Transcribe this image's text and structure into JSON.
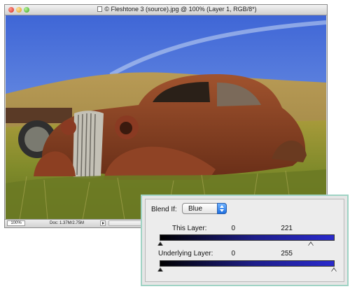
{
  "window": {
    "title": "© Fleshtone 3 (source).jpg @ 100% (Layer 1, RGB/8*)",
    "status_zoom": "100%",
    "status_doc": "Doc: 1.37M/2.75M"
  },
  "blend_if": {
    "label": "Blend If:",
    "channel": "Blue",
    "this_layer": {
      "label": "This Layer:",
      "black_value": "0",
      "white_value": "221",
      "black_level": 0,
      "white_level": 221
    },
    "underlying_layer": {
      "label": "Underlying Layer:",
      "black_value": "0",
      "white_value": "255",
      "black_level": 0,
      "white_level": 255
    },
    "max_level": 255
  },
  "colors": {
    "panel_border": "#9fd3c4",
    "gradient_end": "#2a2acc",
    "stepper_blue": "#1d6fe0"
  }
}
